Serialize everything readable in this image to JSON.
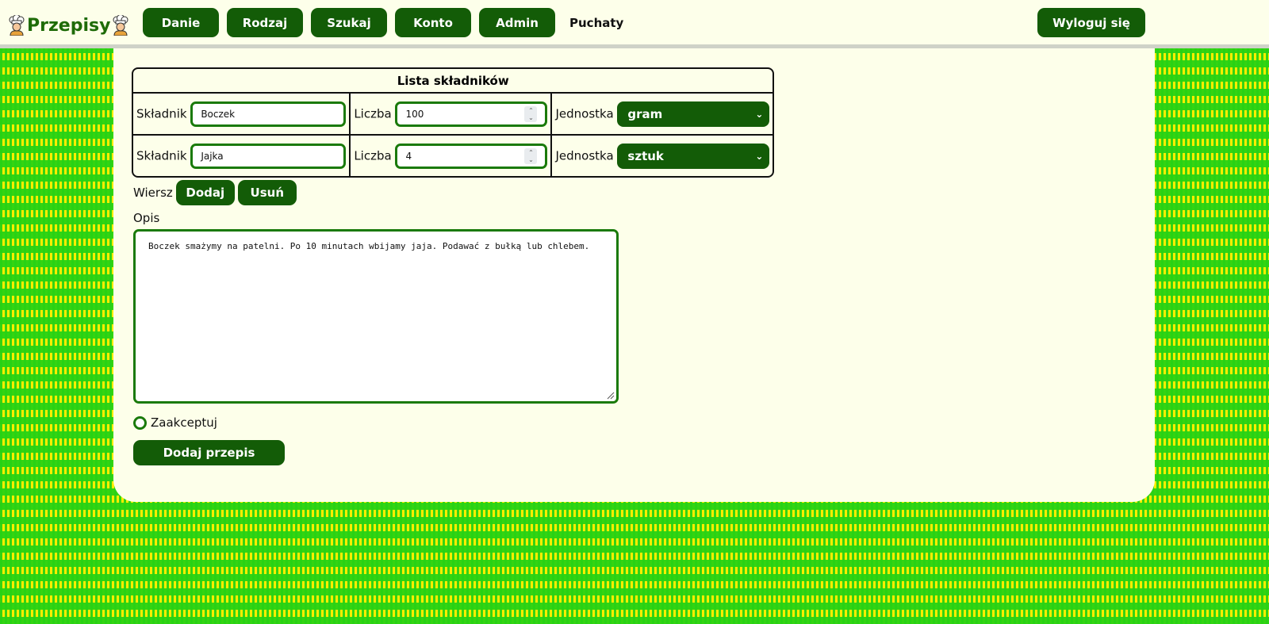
{
  "header": {
    "brand": "Przepisy",
    "nav": [
      {
        "label": "Danie"
      },
      {
        "label": "Rodzaj"
      },
      {
        "label": "Szukaj"
      },
      {
        "label": "Konto"
      },
      {
        "label": "Admin"
      }
    ],
    "username": "Puchaty",
    "logout_label": "Wyloguj się"
  },
  "ingredients": {
    "title": "Lista składników",
    "ingredient_label": "Składnik",
    "quantity_label": "Liczba",
    "unit_label": "Jednostka",
    "rows": [
      {
        "name": "Boczek",
        "quantity": "100",
        "unit": "gram"
      },
      {
        "name": "Jajka",
        "quantity": "4",
        "unit": "sztuk"
      }
    ]
  },
  "row_controls": {
    "label": "Wiersz",
    "add_label": "Dodaj",
    "remove_label": "Usuń"
  },
  "description": {
    "label": "Opis",
    "value": "Boczek smażymy na patelni. Po 10 minutach wbijamy jaja. Podawać z bułką lub chlebem."
  },
  "accept_label": "Zaakceptuj",
  "submit_label": "Dodaj przepis",
  "colors": {
    "accent": "#135c07",
    "field_border": "#1a7a0a",
    "panel_bg": "#fdffea",
    "pattern_yellow": "#ffee00",
    "pattern_green": "#28d214"
  }
}
